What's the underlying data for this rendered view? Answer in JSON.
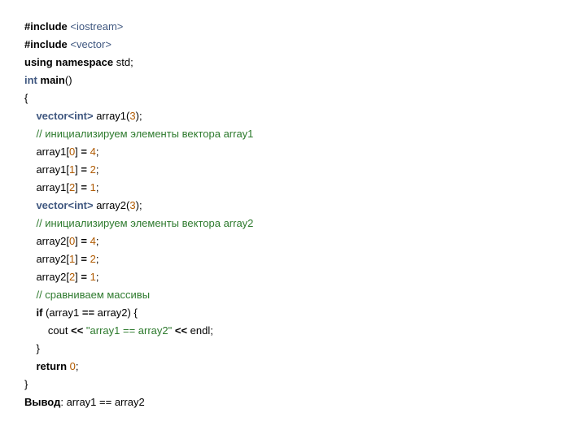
{
  "inc1_a": "#include ",
  "inc1_b": "<iostream>",
  "inc2_a": "#include ",
  "inc2_b": "<vector>",
  "kw_using": "using",
  "kw_namespace": "namespace",
  "std": "std",
  "kw_int": "int",
  "main": "main",
  "vec_tpl_a": "vector<",
  "vec_tpl_b": ">",
  "arr1": "array1",
  "arr2": "array2",
  "n3": "3",
  "n0": "0",
  "n1": "1",
  "n2": "2",
  "n4": "4",
  "cmt1": "// инициализируем элементы вектора array1",
  "cmt2": "// инициализируем элементы вектора array2",
  "cmt3": "// сравниваем массивы",
  "kw_if": "if",
  "cout": "cout",
  "str1": "\"array1 == array2\"",
  "endl": "endl",
  "kw_return": "return",
  "out_label": "Вывод",
  "out_text": ": array1 == array2",
  "semi": ";",
  "lpar": "(",
  "rpar": ")",
  "lbr": "{",
  "rbr": "}",
  "lsq": "[",
  "rsq": "]",
  "eq": " = ",
  "eqeq": " == ",
  "ins": " << ",
  "sp": " "
}
